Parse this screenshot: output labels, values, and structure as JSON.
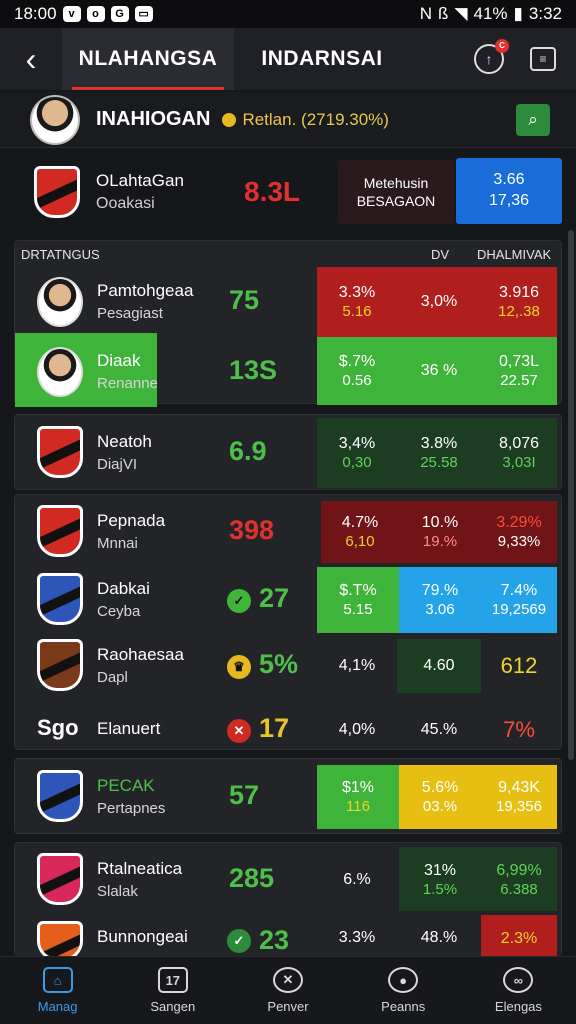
{
  "status": {
    "time": "18:00",
    "battery": "41%",
    "clock": "3:32"
  },
  "header": {
    "back_label": "‹",
    "tabs": [
      "NLAHANGSA",
      "INDARNSAI"
    ],
    "notif_count": "C"
  },
  "user": {
    "name": "INAHIOGAN",
    "stat": "Retlan. (2719.30%)"
  },
  "featured": {
    "title": "OLahtaGan",
    "sub": "Ooakasi",
    "value": "8.3L",
    "box_line1": "Metehusin",
    "box_line2": "BESAGAON",
    "blue_line1": "3.66",
    "blue_line2": "17,36"
  },
  "table": {
    "title": "DRTATNGUS",
    "col1": "DV",
    "col2": "DHALMIVAK",
    "rows": [
      {
        "name": "Pamtohgeaa",
        "sub": "Pesagiast",
        "score": "75",
        "c1a": "3.3%",
        "c1b": "5.16",
        "c2a": "3,0%",
        "c2b": "",
        "c3a": "3.916",
        "c3b": "12,.38"
      },
      {
        "name": "Diaak",
        "sub": "Renanne",
        "score": "13S",
        "c1a": "$.7%",
        "c1b": "0.56",
        "c2a": "36 %",
        "c2b": "",
        "c3a": "0,73L",
        "c3b": "22.57"
      },
      {
        "name": "Neatoh",
        "sub": "DiajVI",
        "score": "6.9",
        "c1a": "3,4%",
        "c1b": "0,30",
        "c2a": "3.8%",
        "c2b": "25.58",
        "c3a": "8,076",
        "c3b": "3,03I"
      },
      {
        "name": "Pepnada",
        "sub": "Mnnai",
        "score": "398",
        "c1a": "4.7%",
        "c1b": "6,10",
        "c2a": "10.%",
        "c2b": "19.%",
        "c3a": "3.29%",
        "c3b": "9,33%"
      },
      {
        "name": "Dabkai",
        "sub": "Ceyba",
        "score": "27",
        "c1a": "$.T%",
        "c1b": "5.15",
        "c2a": "79.%",
        "c2b": "3.06",
        "c3a": "7.4%",
        "c3b": "19,2569"
      },
      {
        "name": "Raohaesaa",
        "sub": "Dapl",
        "score": "5%",
        "c1a": "4,1%",
        "c1b": "",
        "c2a": "4.60",
        "c2b": "",
        "c3a": "612",
        "c3b": ""
      },
      {
        "name": "Elanuert",
        "sub": "",
        "logo_text": "Sgo",
        "score": "17",
        "c1a": "4,0%",
        "c1b": "",
        "c2a": "45.%",
        "c2b": "",
        "c3a": "7%",
        "c3b": ""
      },
      {
        "name": "PECAK",
        "sub": "Pertapnes",
        "score": "57",
        "c1a": "$1%",
        "c1b": "116",
        "c2a": "5.6%",
        "c2b": "03.%",
        "c3a": "9,43K",
        "c3b": "19,356"
      },
      {
        "name": "Rtalneatica",
        "sub": "Slalak",
        "score": "285",
        "c1a": "6.%",
        "c1b": "",
        "c2a": "31%",
        "c2b": "1.5%",
        "c3a": "6,99%",
        "c3b": "6.388"
      },
      {
        "name": "Bunnongeai",
        "sub": "",
        "score": "23",
        "c1a": "3.3%",
        "c1b": "",
        "c2a": "48.%",
        "c2b": "",
        "c3a": "2.3%",
        "c3b": ""
      }
    ]
  },
  "nav": [
    "Manag",
    "Sangen",
    "Penver",
    "Peanns",
    "Elengas"
  ]
}
